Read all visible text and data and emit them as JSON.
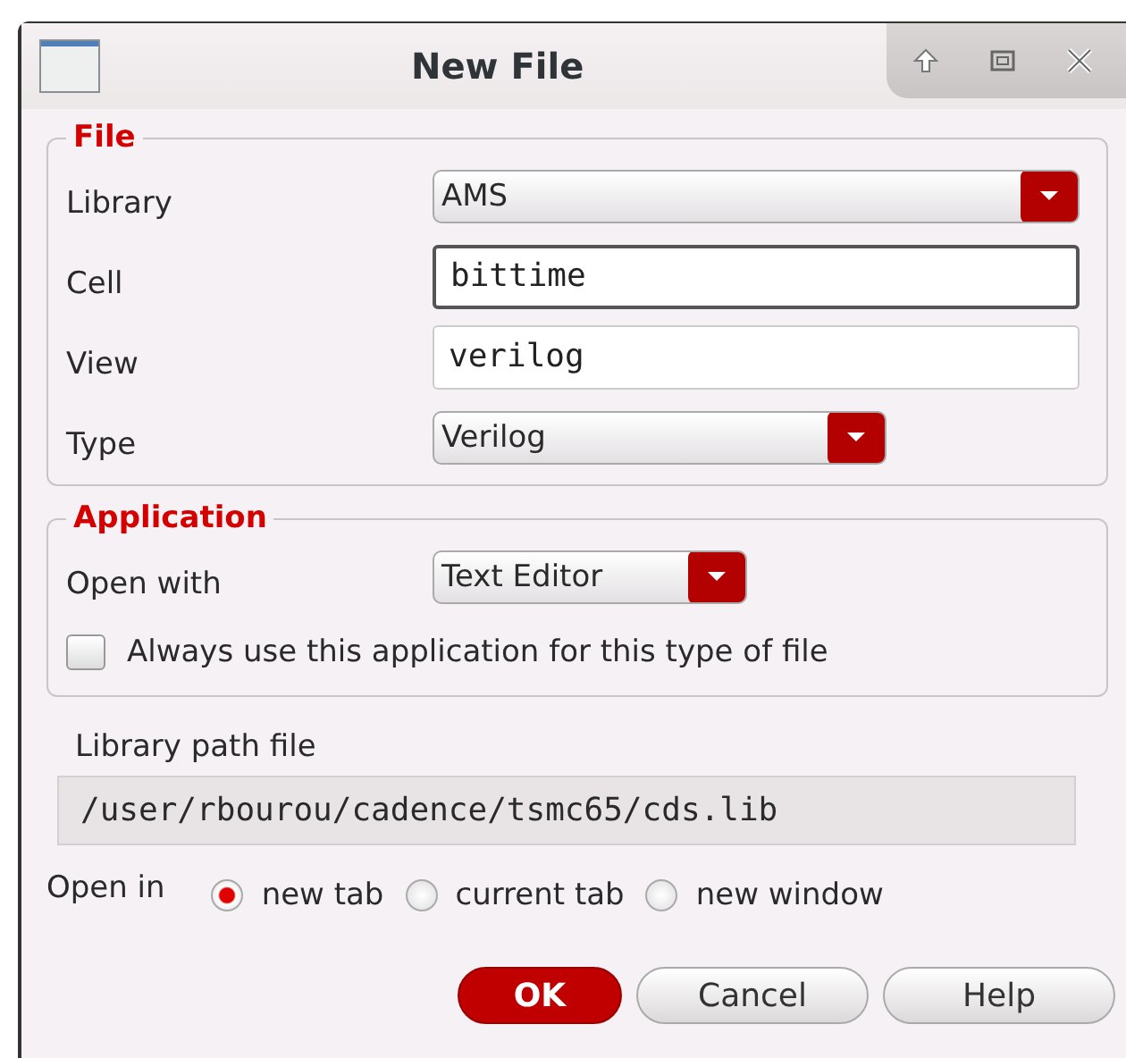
{
  "window": {
    "title": "New File"
  },
  "file_group": {
    "title": "File",
    "rows": [
      {
        "kind": "dropdown",
        "label": "Library",
        "value": "AMS"
      },
      {
        "kind": "input",
        "label": "Cell",
        "value": "bittime",
        "focused": true
      },
      {
        "kind": "input",
        "label": "View",
        "value": "verilog",
        "focused": false
      },
      {
        "kind": "dropdown",
        "label": "Type",
        "value": "Verilog"
      }
    ]
  },
  "application_group": {
    "title": "Application",
    "open_with_label": "Open with",
    "open_with_value": "Text Editor",
    "always_use": {
      "label": "Always use this application for this type of file",
      "checked": false
    }
  },
  "library_path": {
    "label": "Library path file",
    "value": "/user/rbourou/cadence/tsmc65/cds.lib"
  },
  "open_in": {
    "label": "Open in",
    "options": [
      {
        "label": "new tab",
        "selected": true
      },
      {
        "label": "current tab",
        "selected": false
      },
      {
        "label": "new window",
        "selected": false
      }
    ]
  },
  "buttons": [
    {
      "label": "OK",
      "primary": true
    },
    {
      "label": "Cancel",
      "primary": false
    },
    {
      "label": "Help",
      "primary": false
    }
  ]
}
